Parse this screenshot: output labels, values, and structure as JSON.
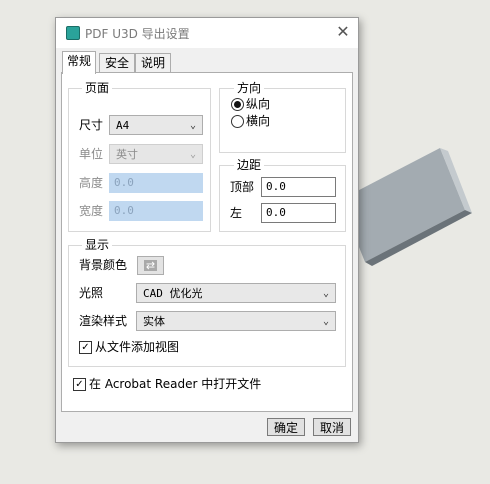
{
  "dialog": {
    "title": "PDF U3D 导出设置",
    "close_symbol": "✕"
  },
  "tabs": [
    {
      "label": "常规",
      "active": true
    },
    {
      "label": "安全",
      "active": false
    },
    {
      "label": "说明",
      "active": false
    }
  ],
  "page_group": {
    "title": "页面",
    "size_label": "尺寸",
    "size_value": "A4",
    "unit_label": "单位",
    "unit_value": "英寸",
    "height_label": "高度",
    "height_value": "0.0",
    "width_label": "宽度",
    "width_value": "0.0"
  },
  "orientation_group": {
    "title": "方向",
    "portrait_label": "纵向",
    "portrait_selected": true,
    "landscape_label": "横向",
    "landscape_selected": false
  },
  "margin_group": {
    "title": "边距",
    "top_label": "顶部",
    "top_value": "0.0",
    "left_label": "左",
    "left_value": "0.0"
  },
  "display_group": {
    "title": "显示",
    "bg_color_label": "背景颜色",
    "lighting_label": "光照",
    "lighting_value": "CAD 优化光",
    "render_style_label": "渲染样式",
    "render_style_value": "实体",
    "add_views_label": "从文件添加视图",
    "add_views_checked": true
  },
  "open_in_reader": {
    "label": "在 Acrobat Reader 中打开文件",
    "checked": true
  },
  "buttons": {
    "ok": "确定",
    "cancel": "取消"
  },
  "colors": {
    "background": "#e9e9e4",
    "slab_top": "#9fa7ad",
    "slab_side": "#70787e",
    "accent": "#2aa39a"
  }
}
